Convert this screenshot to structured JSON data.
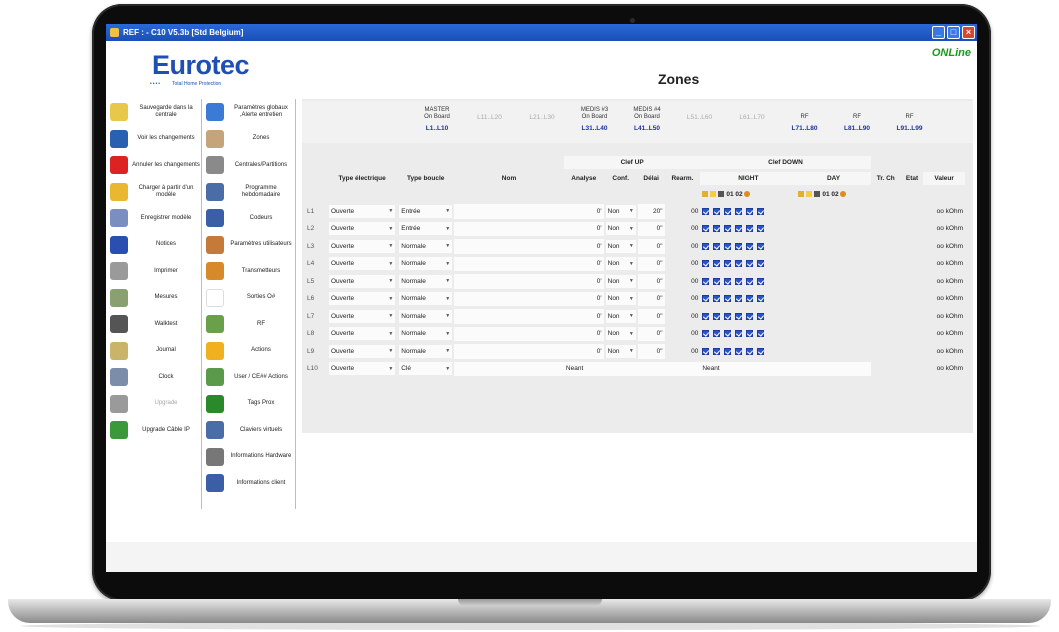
{
  "window": {
    "title": "REF :  - C10 V5.3b [Std Belgium]",
    "status": "ONLine",
    "page_title": "Zones"
  },
  "logo": {
    "name": "Eurotec",
    "tagline": "Total Home Protection"
  },
  "menu_left": [
    {
      "label": "Sauvegarde dans la centrale",
      "icon": "save-to-panel-icon",
      "color": "#e8c84a"
    },
    {
      "label": "Voir les changements",
      "icon": "changes-icon",
      "color": "#2b5fb0"
    },
    {
      "label": "Annuler les changements",
      "icon": "cancel-icon",
      "color": "#d22"
    },
    {
      "label": "Charger à partir d'un modèle",
      "icon": "folder-icon",
      "color": "#e9b830"
    },
    {
      "label": "Enregistrer modèle",
      "icon": "save-template-icon",
      "color": "#7a8fbf"
    },
    {
      "label": "Notices",
      "icon": "book-icon",
      "color": "#2a4fb0"
    },
    {
      "label": "Imprimer",
      "icon": "printer-icon",
      "color": "#9a9a9a"
    },
    {
      "label": "Mesures",
      "icon": "gauge-icon",
      "color": "#8aa070"
    },
    {
      "label": "Walktest",
      "icon": "walk-icon",
      "color": "#555"
    },
    {
      "label": "Journal",
      "icon": "journal-icon",
      "color": "#c9b46a"
    },
    {
      "label": "Clock",
      "icon": "clock-icon",
      "color": "#7b8da8"
    },
    {
      "label": "Upgrade",
      "icon": "upgrade-icon",
      "color": "#9a9a9a",
      "disabled": true
    },
    {
      "label": "Upgrade Câble IP",
      "icon": "network-icon",
      "color": "#3a9a3a"
    }
  ],
  "menu_right": [
    {
      "label": "Paramètres globaux ,Alerte entretien",
      "icon": "globe-icon",
      "color": "#3b7bd6"
    },
    {
      "label": "Zones",
      "icon": "zones-icon",
      "color": "#c6a47a"
    },
    {
      "label": "Centrales/Partitions",
      "icon": "partitions-icon",
      "color": "#8a8a8a"
    },
    {
      "label": "Programme hebdomadaire",
      "icon": "calendar-icon",
      "color": "#4a6da8"
    },
    {
      "label": "Codeurs",
      "icon": "keypad-icon",
      "color": "#3a5fa6"
    },
    {
      "label": "Paramètres utilisateurs",
      "icon": "users-icon",
      "color": "#c57a3a"
    },
    {
      "label": "Transmetteurs",
      "icon": "transmitter-icon",
      "color": "#d88a2a"
    },
    {
      "label": "Sorties O#",
      "icon": "outputs-icon",
      "color": "#ffffff"
    },
    {
      "label": "RF",
      "icon": "rf-icon",
      "color": "#6aa04a"
    },
    {
      "label": "Actions",
      "icon": "lightning-icon",
      "color": "#f0b020"
    },
    {
      "label": "User / CE## Actions",
      "icon": "user-actions-icon",
      "color": "#5a9a4a"
    },
    {
      "label": "Tags Prox",
      "icon": "tags-icon",
      "color": "#2a8a2a"
    },
    {
      "label": "Claviers virtuels",
      "icon": "virtual-keypad-icon",
      "color": "#4a6da8"
    },
    {
      "label": "Informations Hardware",
      "icon": "hardware-icon",
      "color": "#777"
    },
    {
      "label": "Informations client",
      "icon": "client-info-icon",
      "color": "#3a5fa6"
    }
  ],
  "hardware": [
    {
      "label1": "MASTER",
      "label2": "On Board",
      "range": "L1..L10",
      "active": true
    },
    {
      "label1": "",
      "label2": "",
      "range": "L11..L20",
      "active": false
    },
    {
      "label1": "",
      "label2": "",
      "range": "L21..L30",
      "active": false
    },
    {
      "label1": "MEDIS #3",
      "label2": "On Board",
      "range": "L31..L40",
      "active": true
    },
    {
      "label1": "MEDIS #4",
      "label2": "On Board",
      "range": "L41..L50",
      "active": true
    },
    {
      "label1": "",
      "label2": "",
      "range": "L51..L60",
      "active": false
    },
    {
      "label1": "",
      "label2": "",
      "range": "L61..L70",
      "active": false
    },
    {
      "label1": "RF",
      "label2": "",
      "range": "L71..L80",
      "active": true
    },
    {
      "label1": "RF",
      "label2": "",
      "range": "L81..L90",
      "active": true
    },
    {
      "label1": "RF",
      "label2": "",
      "range": "L91..L99",
      "active": true
    }
  ],
  "table": {
    "group_clef_up": "Clef UP",
    "group_clef_down": "Clef DOWN",
    "headers": {
      "type_elec": "Type électrique",
      "type_boucle": "Type boucle",
      "nom": "Nom",
      "analyse": "Analyse",
      "conf": "Conf.",
      "delai": "Délai",
      "rearm": "Rearm.",
      "night": "NIGHT",
      "day": "DAY",
      "trch": "Tr. Ch",
      "etat": "Etat",
      "valeur": "Valeur"
    },
    "legend": "01 02",
    "rows": [
      {
        "id": "L1",
        "type_elec": "Ouverte",
        "type_boucle": "Entrée",
        "nom": "",
        "analyse": "0'",
        "conf": "Non",
        "delai": "20\"",
        "rearm": "00",
        "checks": 6,
        "valeur": "oo kOhm"
      },
      {
        "id": "L2",
        "type_elec": "Ouverte",
        "type_boucle": "Entrée",
        "nom": "",
        "analyse": "0'",
        "conf": "Non",
        "delai": "0\"",
        "rearm": "00",
        "checks": 6,
        "valeur": "oo kOhm"
      },
      {
        "id": "L3",
        "type_elec": "Ouverte",
        "type_boucle": "Normale",
        "nom": "",
        "analyse": "0'",
        "conf": "Non",
        "delai": "0\"",
        "rearm": "00",
        "checks": 6,
        "valeur": "oo kOhm"
      },
      {
        "id": "L4",
        "type_elec": "Ouverte",
        "type_boucle": "Normale",
        "nom": "",
        "analyse": "0'",
        "conf": "Non",
        "delai": "0\"",
        "rearm": "00",
        "checks": 6,
        "valeur": "oo kOhm"
      },
      {
        "id": "L5",
        "type_elec": "Ouverte",
        "type_boucle": "Normale",
        "nom": "",
        "analyse": "0'",
        "conf": "Non",
        "delai": "0\"",
        "rearm": "00",
        "checks": 6,
        "valeur": "oo kOhm"
      },
      {
        "id": "L6",
        "type_elec": "Ouverte",
        "type_boucle": "Normale",
        "nom": "",
        "analyse": "0'",
        "conf": "Non",
        "delai": "0\"",
        "rearm": "00",
        "checks": 6,
        "valeur": "oo kOhm"
      },
      {
        "id": "L7",
        "type_elec": "Ouverte",
        "type_boucle": "Normale",
        "nom": "",
        "analyse": "0'",
        "conf": "Non",
        "delai": "0\"",
        "rearm": "00",
        "checks": 6,
        "valeur": "oo kOhm"
      },
      {
        "id": "L8",
        "type_elec": "Ouverte",
        "type_boucle": "Normale",
        "nom": "",
        "analyse": "0'",
        "conf": "Non",
        "delai": "0\"",
        "rearm": "00",
        "checks": 6,
        "valeur": "oo kOhm"
      },
      {
        "id": "L9",
        "type_elec": "Ouverte",
        "type_boucle": "Normale",
        "nom": "",
        "analyse": "0'",
        "conf": "Non",
        "delai": "0\"",
        "rearm": "00",
        "checks": 6,
        "valeur": "oo kOhm"
      },
      {
        "id": "L10",
        "type_elec": "Ouverte",
        "type_boucle": "Clé",
        "nom": "",
        "neant_up": "Neant",
        "neant_down": "Neant",
        "checks": 0,
        "valeur": "oo kOhm"
      }
    ]
  }
}
